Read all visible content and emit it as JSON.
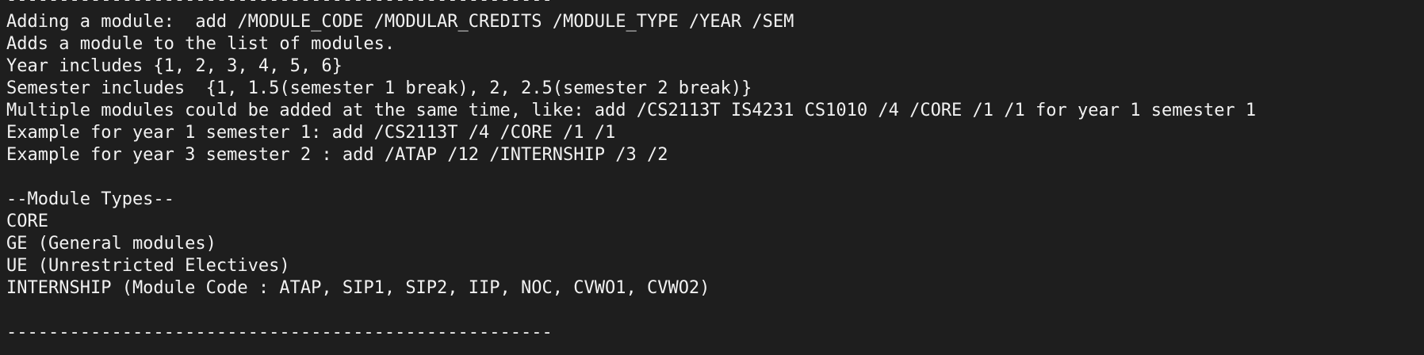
{
  "terminal": {
    "separator_top": "----------------------------------------------------",
    "lines": [
      "Adding a module:  add /MODULE_CODE /MODULAR_CREDITS /MODULE_TYPE /YEAR /SEM",
      "Adds a module to the list of modules.",
      "Year includes {1, 2, 3, 4, 5, 6}",
      "Semester includes  {1, 1.5(semester 1 break), 2, 2.5(semester 2 break)}",
      "Multiple modules could be added at the same time, like: add /CS2113T IS4231 CS1010 /4 /CORE /1 /1 for year 1 semester 1",
      "Example for year 1 semester 1: add /CS2113T /4 /CORE /1 /1",
      "Example for year 3 semester 2 : add /ATAP /12 /INTERNSHIP /3 /2",
      "",
      "--Module Types--",
      "CORE",
      "GE (General modules)",
      "UE (Unrestricted Electives)",
      "INTERNSHIP (Module Code : ATAP, SIP1, SIP2, IIP, NOC, CVWO1, CVWO2)",
      ""
    ],
    "separator_bottom": "----------------------------------------------------"
  }
}
